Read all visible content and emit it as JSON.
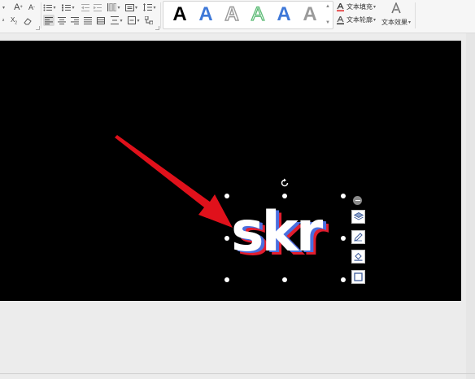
{
  "ribbon": {
    "font_grow_label": "A",
    "font_shrink_label": "A",
    "clear_format_label": "⌫",
    "text_fill_label": "文本填充",
    "text_outline_label": "文本轮廓",
    "text_effect_label": "文本效果",
    "wordart_styles": [
      {
        "name": "black-fill",
        "glyph": "A",
        "color": "#000000"
      },
      {
        "name": "blue-fill",
        "glyph": "A",
        "color": "#3e78d8"
      },
      {
        "name": "gray-outline",
        "glyph": "A",
        "color": "#9a9a9a"
      },
      {
        "name": "green-outline",
        "glyph": "A",
        "color": "#5dbb76"
      },
      {
        "name": "blue-bold",
        "glyph": "A",
        "color": "#3e78d8"
      },
      {
        "name": "gray-fill",
        "glyph": "A",
        "color": "#8f8f8f"
      }
    ],
    "text_fill_color": "#e02020"
  },
  "slide": {
    "wordart_text": "skr",
    "colors": {
      "front": "#ffffff",
      "mid": "#4a6fe0",
      "back": "#e21d2e",
      "arrow": "#e0111b",
      "background": "#000000"
    }
  },
  "icons": {
    "layers": "layers-icon",
    "pen": "pen-icon",
    "fill": "paint-bucket-icon",
    "border": "border-box-icon"
  }
}
